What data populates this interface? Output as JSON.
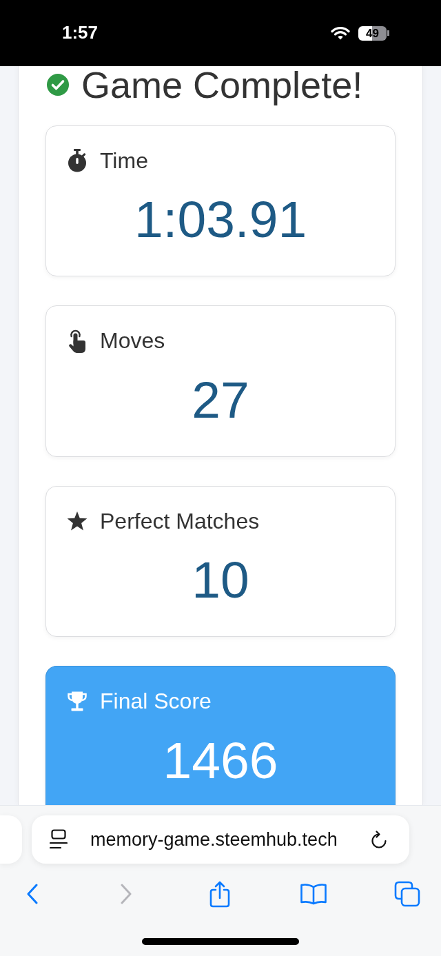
{
  "status_bar": {
    "time": "1:57",
    "battery": "49"
  },
  "page": {
    "title": "Game Complete!",
    "stats": [
      {
        "kind": "time",
        "label": "Time",
        "value": "1:03.91",
        "highlighted": false
      },
      {
        "kind": "moves",
        "label": "Moves",
        "value": "27",
        "highlighted": false
      },
      {
        "kind": "perfect_matches",
        "label": "Perfect Matches",
        "value": "10",
        "highlighted": false
      },
      {
        "kind": "score",
        "label": "Final Score",
        "value": "1466",
        "highlighted": true
      }
    ]
  },
  "browser": {
    "url": "memory-game.steemhub.tech",
    "toolbar": [
      {
        "kind": "back",
        "disabled": false
      },
      {
        "kind": "forward",
        "disabled": true
      },
      {
        "kind": "share",
        "disabled": false
      },
      {
        "kind": "bookmarks",
        "disabled": false
      },
      {
        "kind": "tabs",
        "disabled": false
      }
    ]
  }
}
